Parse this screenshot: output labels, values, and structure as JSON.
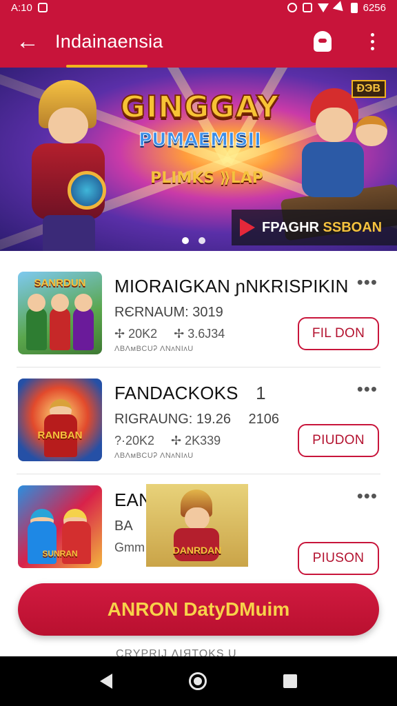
{
  "status_bar": {
    "time": "A:10",
    "clock": "6256"
  },
  "app_bar": {
    "title": "Indainaensia"
  },
  "banner": {
    "title": "GINGGAY",
    "subtitle": "PUMAEMISII",
    "tag": "PLIMKS ⟫LAP",
    "badge": "ĐЭB",
    "strip_text_a": "FPAGHR",
    "strip_text_b": "SSBOAN",
    "page_count": 2,
    "active_page": 1
  },
  "list": [
    {
      "title": "MIORAIGKAN ɲNKRISPIKIN",
      "meta": "RЄRNAUM: 3019",
      "stat_a": "✢ 20K2",
      "stat_b": "✢ 3.6J34",
      "sub": "ɅВɅᴍBCUᎮ ɅNᴧNIᴧU",
      "button": "FIL DON",
      "thumb_label": "SANRDUN"
    },
    {
      "title": "FANDACKOKS",
      "title_num": "1",
      "meta": "RIGRAUNG: 19.26",
      "meta_b": "2106",
      "stat_a": "?·20K2",
      "stat_b": "✢ 2K339",
      "sub": "ɅВɅᴍBCUᎮ ɅNᴧNIᴧU",
      "button": "PIUDON",
      "thumb_label": "RANBAN"
    },
    {
      "title": "EANKIIK",
      "meta": "BA",
      "stat_a": "Gmm",
      "button": "PIUSON",
      "thumb_label": "SUNRAN"
    }
  ],
  "floating_card": {
    "label": "DANRDAN"
  },
  "cta": {
    "label": "ANRON DatyDMuim"
  },
  "bottom_peek": "CRYPRIJ  ɅIЯTOKS  U",
  "colors": {
    "primary": "#c8143a",
    "accent": "#f2b51d"
  }
}
